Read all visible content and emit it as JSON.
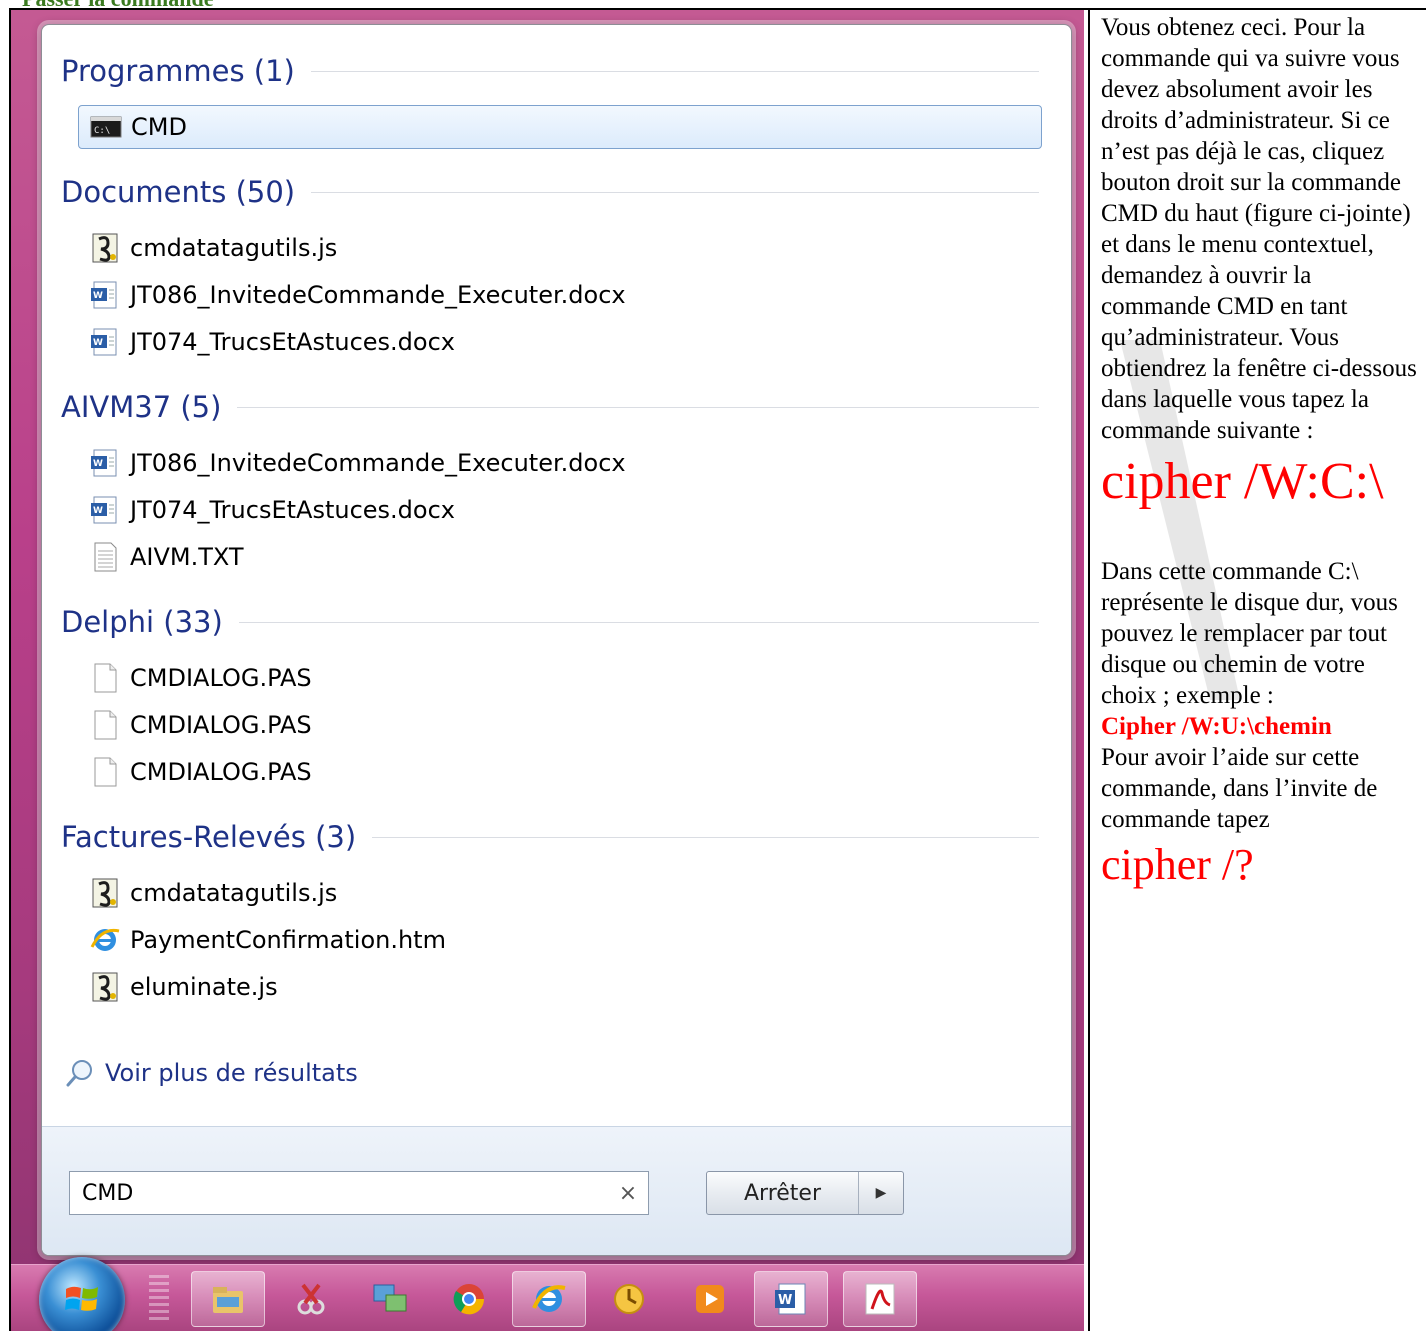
{
  "heading": "Passer la commande",
  "start_menu": {
    "groups": [
      {
        "title": "Programmes (1)",
        "items": [
          {
            "label": "CMD",
            "icon": "cmd-icon",
            "selected": true
          }
        ]
      },
      {
        "title": "Documents (50)",
        "items": [
          {
            "label": "cmdatatagutils.js",
            "icon": "script-file-icon"
          },
          {
            "label": "JT086_InvitedeCommande_Executer.docx",
            "icon": "word-document-icon"
          },
          {
            "label": "JT074_TrucsEtAstuces.docx",
            "icon": "word-document-icon"
          }
        ]
      },
      {
        "title": "AIVM37 (5)",
        "items": [
          {
            "label": "JT086_InvitedeCommande_Executer.docx",
            "icon": "word-document-icon"
          },
          {
            "label": "JT074_TrucsEtAstuces.docx",
            "icon": "word-document-icon"
          },
          {
            "label": "AIVM.TXT",
            "icon": "text-file-icon"
          }
        ]
      },
      {
        "title": "Delphi (33)",
        "items": [
          {
            "label": "CMDIALOG.PAS",
            "icon": "blank-file-icon"
          },
          {
            "label": "CMDIALOG.PAS",
            "icon": "blank-file-icon"
          },
          {
            "label": "CMDIALOG.PAS",
            "icon": "blank-file-icon"
          }
        ]
      },
      {
        "title": "Factures-Relevés (3)",
        "items": [
          {
            "label": "cmdatatagutils.js",
            "icon": "script-file-icon"
          },
          {
            "label": "PaymentConfirmation.htm",
            "icon": "internet-explorer-icon"
          },
          {
            "label": "eluminate.js",
            "icon": "script-file-icon"
          }
        ]
      }
    ],
    "see_more": "Voir plus de résultats",
    "search": {
      "value": "CMD",
      "clear_symbol": "×"
    },
    "stop_button": "Arrêter"
  },
  "taskbar": {
    "buttons": [
      "windows-explorer-icon",
      "snipping-tool-icon",
      "network-icon",
      "chrome-icon",
      "internet-explorer-icon",
      "outlook-icon",
      "media-player-icon",
      "word-icon",
      "acrobat-icon"
    ]
  },
  "side_text": {
    "para1": "Vous obtenez ceci. Pour la commande qui va suivre vous devez absolument avoir les droits d’administrateur. Si ce n’est pas déjà le cas, cliquez bouton droit sur la commande CMD du haut (figure ci-jointe) et dans le menu contextuel, demandez à ouvrir la commande CMD en tant qu’administrateur. Vous obtiendrez la fenêtre ci-dessous dans laquelle vous tapez la commande suivante :",
    "command1": "cipher /W:C:\\",
    "para2": "Dans cette commande C:\\ représente le disque dur, vous pouvez le remplacer par tout disque ou chemin de votre choix ; exemple :",
    "command_example": "Cipher /W:U:\\chemin",
    "para3": "Pour avoir l’aide sur cette commande, dans l’invite de commande tapez",
    "command2": "cipher /?"
  },
  "colors": {
    "command_red": "#ff0000",
    "group_title_blue": "#1e3287",
    "heading_green": "#3a7a1f",
    "taskbar_pink": "#c65899"
  }
}
